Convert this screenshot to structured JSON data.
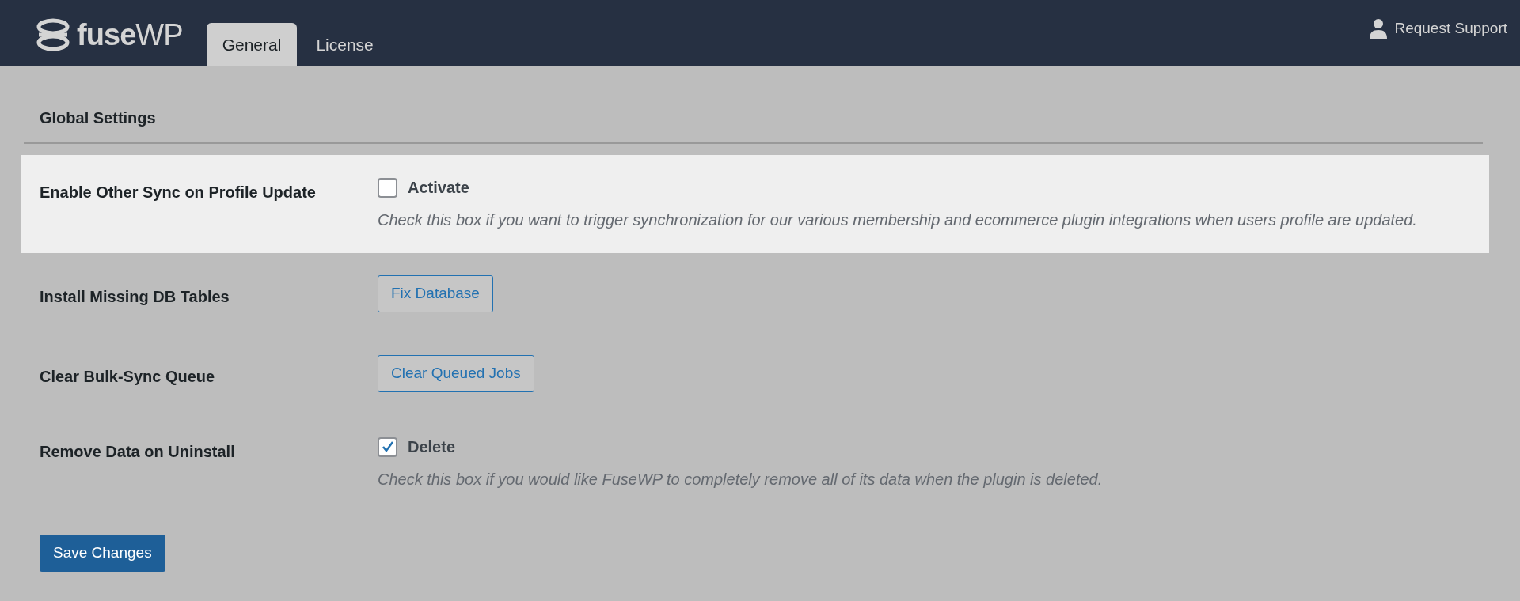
{
  "header": {
    "logo_text": "**fuse**WP",
    "tabs": [
      {
        "label": "General",
        "selected": true
      },
      {
        "label": "License",
        "selected": false
      }
    ],
    "support_link": "Request Support"
  },
  "section_title": "Global Settings",
  "rows": [
    {
      "kind": "checkbox",
      "label": "Enable Other Sync on Profile Update",
      "highlighted": true,
      "checkbox_label": "Activate",
      "checked": false,
      "description": "Check this box if you want to trigger synchronization for our various membership and ecommerce plugin integrations when users profile are updated."
    },
    {
      "kind": "button",
      "label": "Install Missing DB Tables",
      "highlighted": false,
      "button": "Fix Database"
    },
    {
      "kind": "button",
      "label": "Clear Bulk-Sync Queue",
      "highlighted": false,
      "button": "Clear Queued Jobs"
    },
    {
      "kind": "checkbox",
      "label": "Remove Data on Uninstall",
      "highlighted": false,
      "checkbox_label": "Delete",
      "checked": true,
      "description": "Check this box if you would like FuseWP to completely remove all of its data when the plugin is deleted."
    }
  ],
  "save_button": "Save Changes"
}
